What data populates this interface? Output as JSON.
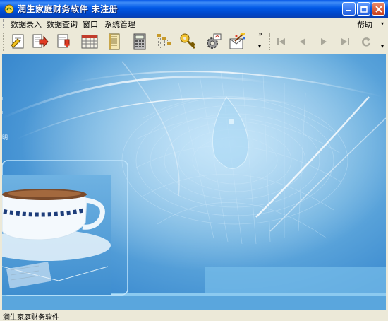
{
  "window": {
    "title": "润生家庭财务软件  未注册"
  },
  "menu": {
    "items": [
      "数据录入",
      "数据查询",
      "窗口",
      "系统管理"
    ],
    "help": "帮助"
  },
  "toolbar": {
    "buttons": [
      "new-record-icon",
      "export-icon",
      "import-icon",
      "table-icon",
      "ledger-icon",
      "calculator-icon",
      "tree-icon",
      "key-icon",
      "settings-icon",
      "wizard-icon"
    ],
    "nav": [
      "first-icon",
      "previous-icon",
      "next-icon",
      "last-icon",
      "refresh-icon"
    ]
  },
  "canvas": {
    "side_mark": "明"
  },
  "status": {
    "text": "润生家庭财务软件"
  },
  "colors": {
    "titlebar": "#0058e6",
    "chrome": "#ece9d8",
    "canvas": "#4b9ad6"
  }
}
